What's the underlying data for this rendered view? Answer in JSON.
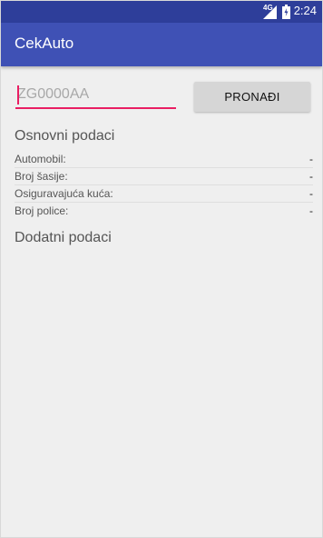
{
  "status_bar": {
    "network_label": "4G",
    "time": "2:24",
    "icons": [
      "signal-icon",
      "battery-icon"
    ]
  },
  "app_bar": {
    "title": "CekAuto"
  },
  "search": {
    "placeholder": "ZG0000AA",
    "value": "",
    "button_label": "PRONAĐI"
  },
  "basic_info": {
    "title": "Osnovni podaci",
    "rows": [
      {
        "label": "Automobil:",
        "value": "-"
      },
      {
        "label": "Broj šasije:",
        "value": "-"
      },
      {
        "label": "Osiguravajuća kuća:",
        "value": "-"
      },
      {
        "label": "Broj police:",
        "value": "-"
      }
    ]
  },
  "extra_info": {
    "title": "Dodatni podaci"
  },
  "colors": {
    "status_bar": "#2e3e9a",
    "app_bar": "#3f51b5",
    "accent": "#e91e63",
    "background": "#efefef",
    "button": "#d6d6d6"
  }
}
